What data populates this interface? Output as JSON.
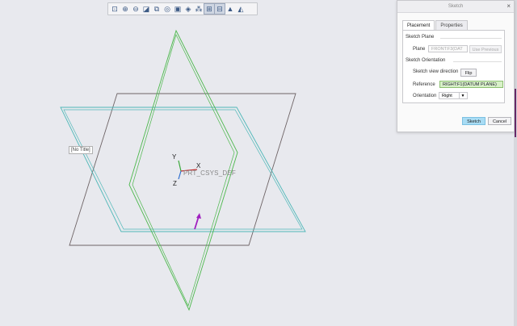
{
  "toolbar": {
    "buttons": [
      {
        "icon": "refit-icon",
        "glyph": "⊡"
      },
      {
        "icon": "zoom-in-icon",
        "glyph": "⊕"
      },
      {
        "icon": "zoom-out-icon",
        "glyph": "⊖"
      },
      {
        "icon": "repaint-icon",
        "glyph": "◪"
      },
      {
        "icon": "view-orient-icon",
        "glyph": "⧉"
      },
      {
        "icon": "saved-views-icon",
        "glyph": "◎"
      },
      {
        "icon": "display-style-icon",
        "glyph": "▣"
      },
      {
        "icon": "view-manager-icon",
        "glyph": "◈"
      },
      {
        "icon": "datum-display-icon",
        "glyph": "⁂"
      },
      {
        "icon": "sketch-view-icon",
        "glyph": "⊞",
        "active": true
      },
      {
        "icon": "sketcher-display-icon",
        "glyph": "⊟",
        "active": true
      },
      {
        "icon": "annotation-icon",
        "glyph": "▲"
      },
      {
        "icon": "spin-center-icon",
        "glyph": "◭"
      }
    ]
  },
  "canvas": {
    "no_title_label": "[No Title]",
    "csys": {
      "x_label": "X",
      "y_label": "Y",
      "z_label": "Z",
      "name": "PRT_CSYS_DEF"
    }
  },
  "dialog": {
    "title": "Sketch",
    "close": "×",
    "tabs": [
      "Placement",
      "Properties"
    ],
    "sketch_plane": {
      "group_label": "Sketch Plane",
      "plane_label": "Plane",
      "plane_value": "FRONT:F3(DAT",
      "use_previous": "Use Previous"
    },
    "orientation": {
      "group_label": "Sketch Orientation",
      "view_direction_label": "Sketch view direction",
      "flip": "Flip",
      "reference_label": "Reference",
      "reference_value": "RIGHT:F1(DATUM PLANE)",
      "orientation_label": "Orientation",
      "orientation_value": "Right"
    },
    "buttons": {
      "sketch": "Sketch",
      "cancel": "Cancel"
    }
  },
  "colors": {
    "background": "#e8e9ee",
    "plane_gray": "#6e6466",
    "plane_teal": "#4fb8b8",
    "plane_green": "#4cb84c",
    "arrow_magenta": "#a020c0",
    "primary_button": "#a8dcf4"
  }
}
